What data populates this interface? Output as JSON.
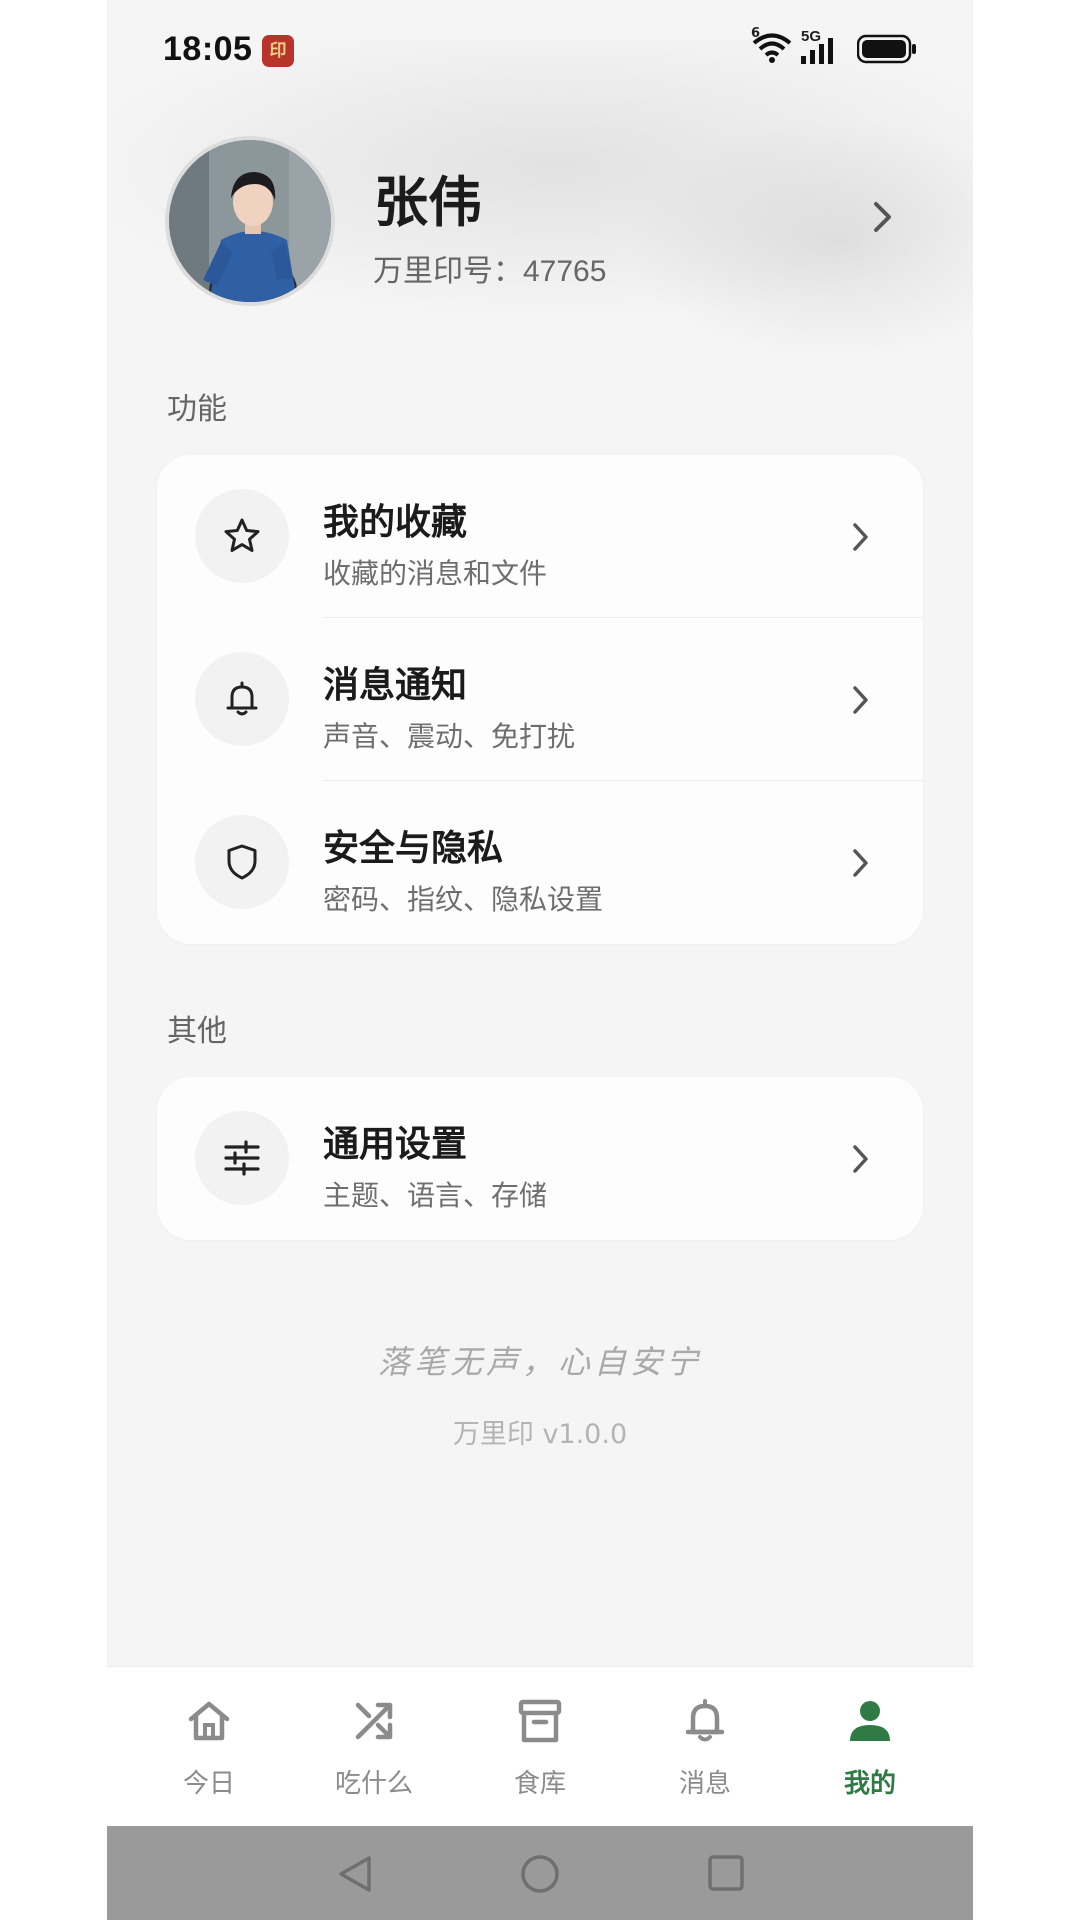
{
  "status_bar": {
    "time": "18:05",
    "app_badge": "印",
    "wifi_badge": "6",
    "network": "5G"
  },
  "profile": {
    "name": "张伟",
    "id_label": "万里印号：",
    "id_value": "47765"
  },
  "sections": {
    "features": {
      "title": "功能",
      "items": [
        {
          "title": "我的收藏",
          "subtitle": "收藏的消息和文件",
          "icon": "star-icon"
        },
        {
          "title": "消息通知",
          "subtitle": "声音、震动、免打扰",
          "icon": "bell-icon"
        },
        {
          "title": "安全与隐私",
          "subtitle": "密码、指纹、隐私设置",
          "icon": "shield-icon"
        }
      ]
    },
    "other": {
      "title": "其他",
      "items": [
        {
          "title": "通用设置",
          "subtitle": "主题、语言、存储",
          "icon": "sliders-icon"
        }
      ]
    }
  },
  "footer": {
    "quote": "落笔无声，心自安宁",
    "version": "万里印 v1.0.0"
  },
  "tabbar": {
    "tabs": [
      {
        "label": "今日",
        "icon": "home-icon",
        "active": false
      },
      {
        "label": "吃什么",
        "icon": "shuffle-icon",
        "active": false
      },
      {
        "label": "食库",
        "icon": "archive-icon",
        "active": false
      },
      {
        "label": "消息",
        "icon": "bell-icon",
        "active": false
      },
      {
        "label": "我的",
        "icon": "person-icon",
        "active": true
      }
    ]
  },
  "colors": {
    "accent": "#2f7a45",
    "background": "#f5f5f5",
    "card": "#fdfdfd",
    "nav_bar": "#9a9a9a"
  }
}
